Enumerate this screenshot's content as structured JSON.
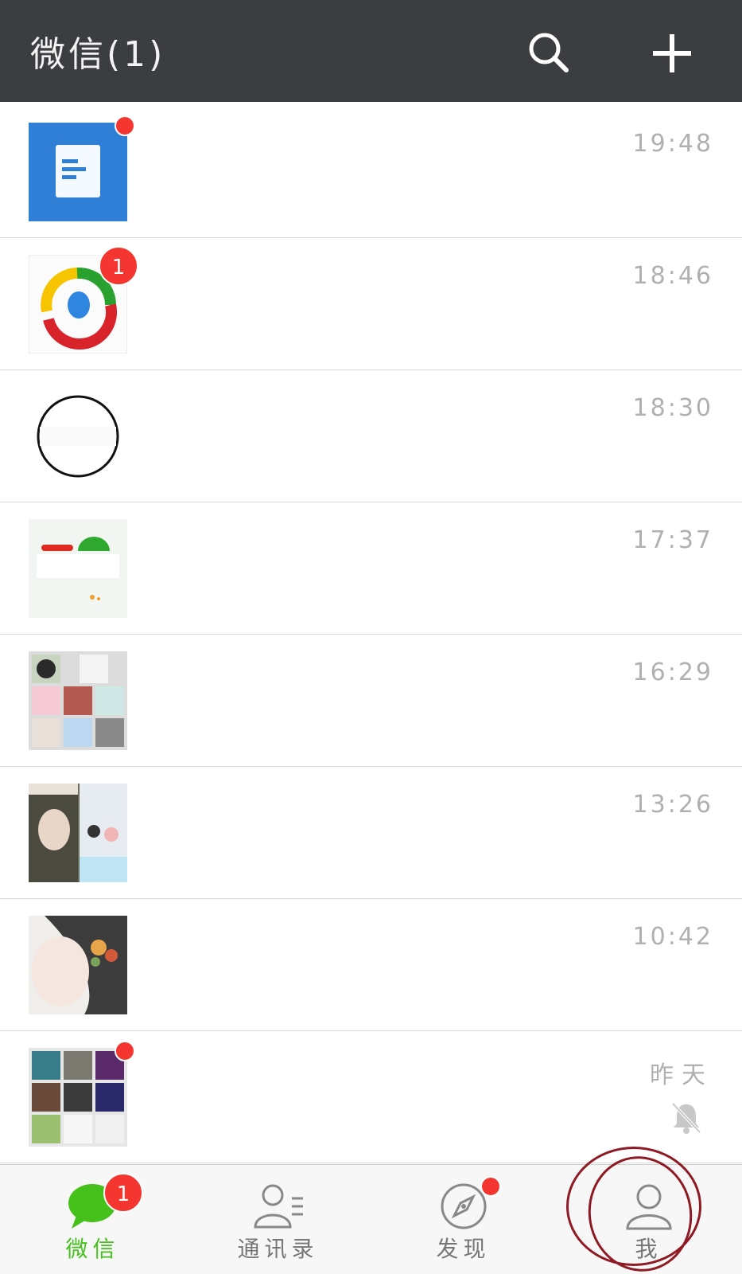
{
  "header": {
    "title": "微信(1)",
    "search_icon": "search-icon",
    "add_icon": "plus-icon"
  },
  "chats": [
    {
      "time": "19:48",
      "avatar": "document-app-avatar",
      "unread_dot": true
    },
    {
      "time": "18:46",
      "avatar": "qq-news-avatar",
      "badge": "1"
    },
    {
      "time": "18:30",
      "avatar": "circle-avatar"
    },
    {
      "time": "17:37",
      "avatar": "logo-avatar"
    },
    {
      "time": "16:29",
      "avatar": "group-avatar"
    },
    {
      "time": "13:26",
      "avatar": "girl-photo-avatar"
    },
    {
      "time": "10:42",
      "avatar": "illustration-avatar"
    },
    {
      "time": "昨天",
      "avatar": "group-photo-avatar",
      "unread_dot": true,
      "muted": true
    }
  ],
  "tabs": [
    {
      "label": "微信",
      "icon": "chat-bubble-icon",
      "active": true,
      "badge": "1"
    },
    {
      "label": "通讯录",
      "icon": "contacts-icon"
    },
    {
      "label": "发现",
      "icon": "compass-icon",
      "unread_dot": true
    },
    {
      "label": "我",
      "icon": "person-icon"
    }
  ],
  "colors": {
    "header_bg": "#3b3d40",
    "accent_green": "#46c01b",
    "badge_red": "#f43530",
    "time_gray": "#b0b0b0"
  }
}
